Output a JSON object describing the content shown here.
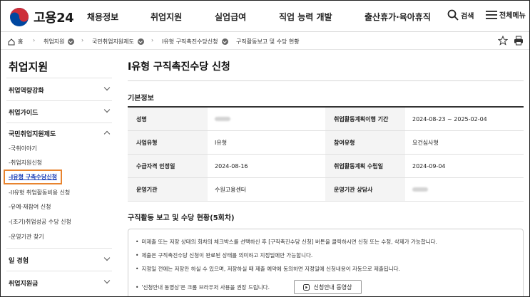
{
  "header": {
    "logo_text": "고용24",
    "nav": [
      "채용정보",
      "취업지원",
      "실업급여",
      "직업 능력 개발",
      "출산휴가·육아휴직"
    ],
    "search_label": "검색",
    "all_menu_label": "전체메뉴"
  },
  "breadcrumb": {
    "home": "홈",
    "items": [
      "취업지원",
      "국민취업지원제도",
      "I유형 구직촉진수당신청",
      "구직활동보고 및 수당 현황"
    ]
  },
  "sidebar": {
    "title": "취업지원",
    "sections": [
      {
        "label": "취업역량강화"
      },
      {
        "label": "취업가이드"
      },
      {
        "label": "국민취업지원제도"
      }
    ],
    "sub_items": [
      "-국취이야기",
      "-취업지원신청",
      "-I유형 구촉수당신청",
      "-II유형 취업활동비용 신청",
      "-유예·재참여 신청",
      "-(조기)취업성공 수당 신청",
      "-운영기관 찾기"
    ],
    "more_sections": [
      "일 경험",
      "취업지원금"
    ]
  },
  "main": {
    "title": "I유형 구직촉진수당 신청",
    "basic_info_title": "기본정보",
    "rows": [
      {
        "l1": "성명",
        "v1": "",
        "l2": "취업활동계획이행 기간",
        "v2": "2024-08-23 ~ 2025-02-04"
      },
      {
        "l1": "사업유형",
        "v1": "I유형",
        "l2": "참여유형",
        "v2": "요건심사형"
      },
      {
        "l1": "수급자격 인정일",
        "v1": "2024-08-16",
        "l2": "취업활동계획 수립일",
        "v2": "2024-09-04"
      },
      {
        "l1": "운영기관",
        "v1": "수원고용센터",
        "l2": "운영기관 상담사",
        "v2": ""
      }
    ],
    "report_title": "구직활동 보고 및 수당 현황(5회차)",
    "notices": [
      "미제출 또는 저장 상태의 회차의 체크박스를 선택하신 후 [구직촉진수당 신청] 버튼을 클릭하시면 신청 또는 수정, 삭제가 가능합니다.",
      "제출은 구직촉진수당 신청이 완료된 상태를 의미하고 지정일에만 가능합니다.",
      "지정일 전에는 저장만 하실 수 있으며, 저장하실 때 제출 예약에 동의하면 지정일에 신청내용이 자동으로 제출됩니다.",
      "'신청안내 동영상'은 크롬 브라우저 사용을 권장 드립니다."
    ],
    "guide_button": "신청안내 동영상"
  },
  "colors": {
    "highlight": "#e8842f",
    "active_link": "#1a3fb8",
    "logo_red": "#cd2e3a",
    "logo_blue": "#0047a0"
  }
}
